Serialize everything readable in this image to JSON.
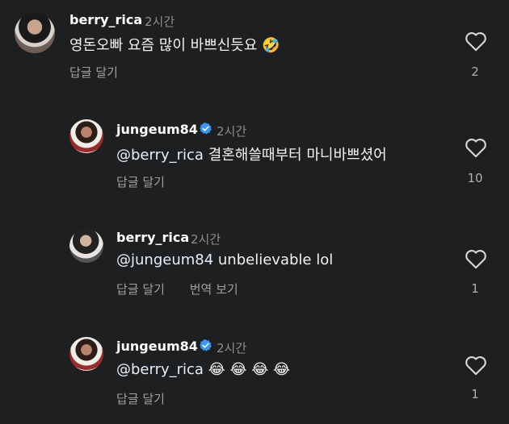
{
  "comments": [
    {
      "username": "berry_rica",
      "time": "2시간",
      "text": "영돈오빠 요즘 많이 바쁘신듯요",
      "emoji": "🤣",
      "reply": "답글 달기",
      "likes": "2"
    },
    {
      "username": "jungeum84",
      "time": "2시간",
      "mention": "@berry_rica",
      "text": " 결혼해쓸때부터 마니바쁘셨어",
      "reply": "답글 달기",
      "likes": "10"
    },
    {
      "username": "berry_rica",
      "time": "2시간",
      "mention": "@jungeum84",
      "text": " unbelievable lol",
      "reply": "답글 달기",
      "translate": "번역 보기",
      "likes": "1"
    },
    {
      "username": "jungeum84",
      "time": "2시간",
      "mention": "@berry_rica",
      "emoji": "😂 😂 😂 😂",
      "reply": "답글 달기",
      "likes": "1"
    }
  ],
  "icons": {
    "heart": "heart-icon",
    "verified": "verified-badge-icon"
  },
  "colors": {
    "background": "#1e1f21",
    "verified": "#3897f0"
  }
}
